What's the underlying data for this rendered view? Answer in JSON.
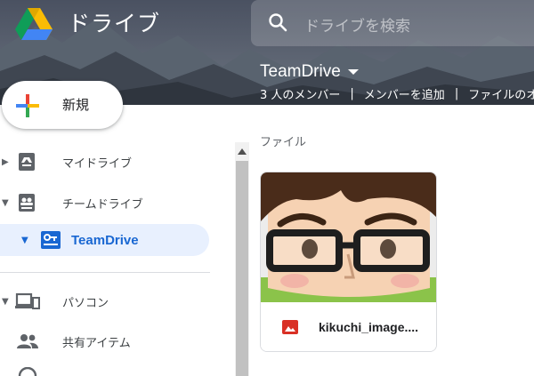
{
  "header": {
    "title": "ドライブ",
    "search_placeholder": "ドライブを検索"
  },
  "team_drive": {
    "name": "TeamDrive",
    "members": "3 人のメンバー",
    "add_members": "メンバーを追加",
    "file_org": "ファイルのオー"
  },
  "new_button": {
    "label": "新規"
  },
  "sidebar": {
    "items": [
      {
        "label": "マイドライブ",
        "icon": "drive-icon"
      },
      {
        "label": "チームドライブ",
        "icon": "team-drives-icon"
      },
      {
        "label": "TeamDrive",
        "icon": "team-drive-icon"
      },
      {
        "label": "パソコン",
        "icon": "computer-icon"
      },
      {
        "label": "共有アイテム",
        "icon": "shared-icon"
      }
    ]
  },
  "main": {
    "section_label": "ファイル",
    "files": [
      {
        "name": "kikuchi_image....",
        "type_icon": "image-file-icon"
      }
    ]
  },
  "colors": {
    "accent_blue": "#1967d2",
    "active_bg": "#e8f0fe",
    "image_icon_red": "#d93025"
  }
}
